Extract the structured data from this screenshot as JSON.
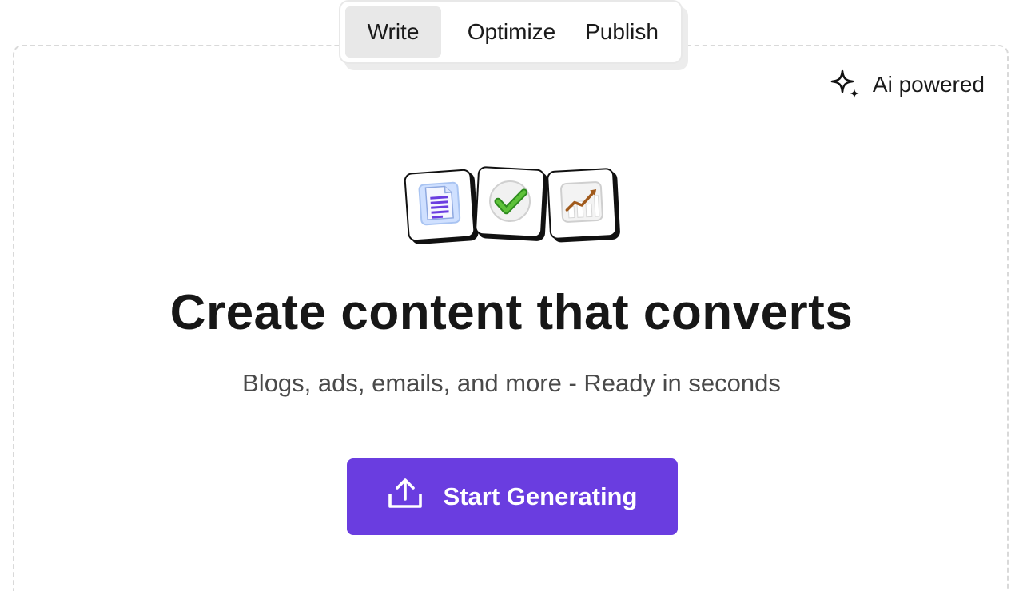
{
  "tabs": [
    {
      "label": "Write",
      "active": true
    },
    {
      "label": "Optimize",
      "active": false
    },
    {
      "label": "Publish",
      "active": false
    }
  ],
  "badge": {
    "label": "Ai powered",
    "icon": "sparkle-icon"
  },
  "feature_icons": [
    "document-icon",
    "checkmark-icon",
    "growth-chart-icon"
  ],
  "hero": {
    "title": "Create content that converts",
    "subtitle": "Blogs, ads, emails, and more - Ready in seconds"
  },
  "cta": {
    "label": "Start Generating",
    "icon": "upload-icon"
  },
  "colors": {
    "accent": "#6a3de0",
    "text": "#171717",
    "muted": "#4a4a4a",
    "tab_active_bg": "#e8e8e8"
  }
}
